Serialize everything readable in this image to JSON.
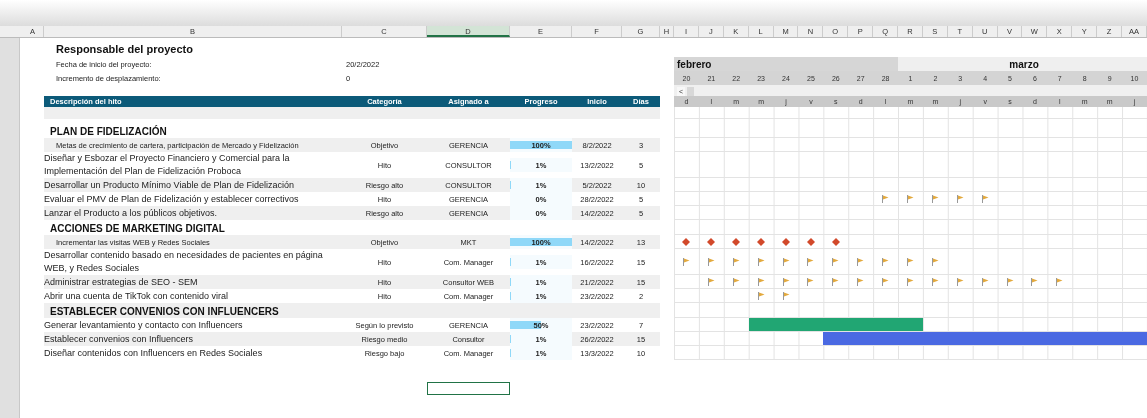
{
  "column_headers": [
    {
      "label": "A",
      "selected": false
    },
    {
      "label": "B",
      "selected": false
    },
    {
      "label": "C",
      "selected": false
    },
    {
      "label": "D",
      "selected": true
    },
    {
      "label": "E",
      "selected": false
    },
    {
      "label": "F",
      "selected": false
    },
    {
      "label": "G",
      "selected": false
    },
    {
      "label": "H",
      "selected": false
    },
    {
      "label": "I",
      "selected": false
    },
    {
      "label": "J",
      "selected": false
    },
    {
      "label": "K",
      "selected": false
    },
    {
      "label": "L",
      "selected": false
    },
    {
      "label": "M",
      "selected": false
    },
    {
      "label": "N",
      "selected": false
    },
    {
      "label": "O",
      "selected": false
    },
    {
      "label": "P",
      "selected": false
    },
    {
      "label": "Q",
      "selected": false
    },
    {
      "label": "R",
      "selected": false
    },
    {
      "label": "S",
      "selected": false
    },
    {
      "label": "T",
      "selected": false
    },
    {
      "label": "U",
      "selected": false
    },
    {
      "label": "V",
      "selected": false
    },
    {
      "label": "W",
      "selected": false
    },
    {
      "label": "X",
      "selected": false
    },
    {
      "label": "Y",
      "selected": false
    },
    {
      "label": "Z",
      "selected": false
    },
    {
      "label": "AA",
      "selected": false
    }
  ],
  "project": {
    "title": "Responsable del proyecto",
    "fields": [
      {
        "label": "Fecha de inicio del proyecto:",
        "value": "20/2/2022"
      },
      {
        "label": "Incremento de desplazamiento:",
        "value": "0"
      }
    ]
  },
  "timeline": {
    "scroll_button": "<",
    "months": [
      {
        "label": "febrero",
        "days": [
          {
            "day": "20",
            "weekday": "d"
          },
          {
            "day": "21",
            "weekday": "l"
          },
          {
            "day": "22",
            "weekday": "m"
          },
          {
            "day": "23",
            "weekday": "m"
          },
          {
            "day": "24",
            "weekday": "j"
          },
          {
            "day": "25",
            "weekday": "v"
          },
          {
            "day": "26",
            "weekday": "s"
          },
          {
            "day": "27",
            "weekday": "d"
          },
          {
            "day": "28",
            "weekday": "l"
          }
        ]
      },
      {
        "label": "marzo",
        "days": [
          {
            "day": "1",
            "weekday": "m"
          },
          {
            "day": "2",
            "weekday": "m"
          },
          {
            "day": "3",
            "weekday": "j"
          },
          {
            "day": "4",
            "weekday": "v"
          },
          {
            "day": "5",
            "weekday": "s"
          },
          {
            "day": "6",
            "weekday": "d"
          },
          {
            "day": "7",
            "weekday": "l"
          },
          {
            "day": "8",
            "weekday": "m"
          },
          {
            "day": "9",
            "weekday": "m"
          },
          {
            "day": "10",
            "weekday": "j"
          }
        ]
      }
    ]
  },
  "table": {
    "columns": [
      "Descripción del hito",
      "Categoría",
      "Asignado a",
      "Progreso",
      "Inicio",
      "Días"
    ],
    "rows": [
      {
        "kind": "section",
        "title": "PLAN DE FIDELIZACIÓN"
      },
      {
        "kind": "objective",
        "description": "Metas de crecimiento de cartera, participación de Mercado y Fidelización",
        "category": "Objetivo",
        "assigned": "GERENCIA",
        "progress": "100%",
        "level": 1,
        "start": "8/2/2022",
        "days": "3"
      },
      {
        "kind": "task",
        "description": "Diseñar y Esbozar el Proyecto Financiero y Comercial para la Implementación del Plan de Fidelización Proboca",
        "category": "Hito",
        "assigned": "CONSULTOR",
        "progress": "1%",
        "level": 0.01,
        "start": "13/2/2022",
        "days": "5"
      },
      {
        "kind": "task",
        "description": "Desarrollar un Producto Mínimo Viable de Plan de Fidelización",
        "category": "Riesgo alto",
        "assigned": "CONSULTOR",
        "progress": "1%",
        "level": 0.01,
        "start": "5/2/2022",
        "days": "10"
      },
      {
        "kind": "task",
        "description": "Evaluar el PMV de Plan de Fidelización y establecer correctivos",
        "category": "Hito",
        "assigned": "GERENCIA",
        "progress": "0%",
        "start": "28/2/2022",
        "days": "5",
        "gantt": [
          {
            "kind": "none"
          },
          {
            "kind": "none"
          },
          {
            "kind": "none"
          },
          {
            "kind": "none"
          },
          {
            "kind": "none"
          },
          {
            "kind": "none"
          },
          {
            "kind": "none"
          },
          {
            "kind": "none"
          },
          {
            "kind": "flag"
          },
          {
            "kind": "flag"
          },
          {
            "kind": "flag"
          },
          {
            "kind": "flag"
          },
          {
            "kind": "flag"
          }
        ]
      },
      {
        "kind": "task",
        "description": "Lanzar el Producto a los públicos objetivos.",
        "category": "Riesgo alto",
        "assigned": "GERENCIA",
        "progress": "0%",
        "start": "14/2/2022",
        "days": "5"
      },
      {
        "kind": "section",
        "title": "ACCIONES DE MARKETING DIGITAL"
      },
      {
        "kind": "objective",
        "description": "Incrementar las visitas WEB y Redes Sociales",
        "category": "Objetivo",
        "assigned": "MKT",
        "progress": "100%",
        "level": 1,
        "start": "14/2/2022",
        "days": "13",
        "gantt": [
          {
            "kind": "diamond"
          },
          {
            "kind": "diamond"
          },
          {
            "kind": "diamond"
          },
          {
            "kind": "diamond"
          },
          {
            "kind": "diamond"
          },
          {
            "kind": "diamond"
          },
          {
            "kind": "diamond"
          }
        ]
      },
      {
        "kind": "task",
        "description": "Desarrollar contenido basado en necesidades de pacientes en página WEB, y Redes Sociales",
        "category": "Hito",
        "assigned": "Com. Manager",
        "progress": "1%",
        "level": 0.01,
        "start": "16/2/2022",
        "days": "15",
        "gantt": [
          {
            "kind": "flag"
          },
          {
            "kind": "flag"
          },
          {
            "kind": "flag"
          },
          {
            "kind": "flag"
          },
          {
            "kind": "flag"
          },
          {
            "kind": "flag"
          },
          {
            "kind": "flag"
          },
          {
            "kind": "flag"
          },
          {
            "kind": "flag"
          },
          {
            "kind": "flag"
          },
          {
            "kind": "flag"
          }
        ]
      },
      {
        "kind": "task",
        "description": "Administrar estrategias de SEO - SEM",
        "category": "Hito",
        "assigned": "Consultor WEB",
        "progress": "1%",
        "level": 0.01,
        "start": "21/2/2022",
        "days": "15",
        "gantt": [
          {
            "kind": "none"
          },
          {
            "kind": "flag"
          },
          {
            "kind": "flag"
          },
          {
            "kind": "flag"
          },
          {
            "kind": "flag"
          },
          {
            "kind": "flag"
          },
          {
            "kind": "flag"
          },
          {
            "kind": "flag"
          },
          {
            "kind": "flag"
          },
          {
            "kind": "flag"
          },
          {
            "kind": "flag"
          },
          {
            "kind": "flag"
          },
          {
            "kind": "flag"
          },
          {
            "kind": "flag"
          },
          {
            "kind": "flag"
          },
          {
            "kind": "flag"
          }
        ]
      },
      {
        "kind": "task",
        "description": "Abrir una cuenta de TikTok con contenido viral",
        "category": "Hito",
        "assigned": "Com. Manager",
        "progress": "1%",
        "level": 0.01,
        "start": "23/2/2022",
        "days": "2",
        "gantt": [
          {
            "kind": "none"
          },
          {
            "kind": "none"
          },
          {
            "kind": "none"
          },
          {
            "kind": "flag"
          },
          {
            "kind": "flag"
          }
        ]
      },
      {
        "kind": "section",
        "title": "ESTABLECER CONVENIOS CON INFLUENCERS"
      },
      {
        "kind": "task",
        "description": "Generar levantamiento y contacto con Influencers",
        "category": "Según lo previsto",
        "assigned": "GERENCIA",
        "progress": "50%",
        "level": 0.5,
        "start": "23/2/2022",
        "days": "7",
        "color": "#21a673",
        "gantt": [
          {
            "kind": "none"
          },
          {
            "kind": "none"
          },
          {
            "kind": "none"
          },
          {
            "kind": "bar"
          },
          {
            "kind": "bar"
          },
          {
            "kind": "bar"
          },
          {
            "kind": "bar"
          },
          {
            "kind": "bar"
          },
          {
            "kind": "bar"
          },
          {
            "kind": "bar"
          }
        ]
      },
      {
        "kind": "task",
        "description": "Establecer convenios con Influencers",
        "category": "Riesgo medio",
        "assigned": "Consultor",
        "progress": "1%",
        "level": 0.01,
        "start": "26/2/2022",
        "days": "15",
        "color": "#4a69e2",
        "gantt": [
          {
            "kind": "none"
          },
          {
            "kind": "none"
          },
          {
            "kind": "none"
          },
          {
            "kind": "none"
          },
          {
            "kind": "none"
          },
          {
            "kind": "none"
          },
          {
            "kind": "bar"
          },
          {
            "kind": "bar"
          },
          {
            "kind": "bar"
          },
          {
            "kind": "bar"
          },
          {
            "kind": "bar"
          },
          {
            "kind": "bar"
          },
          {
            "kind": "bar"
          },
          {
            "kind": "bar"
          },
          {
            "kind": "bar"
          },
          {
            "kind": "bar"
          },
          {
            "kind": "bar"
          },
          {
            "kind": "bar"
          },
          {
            "kind": "bar"
          }
        ]
      },
      {
        "kind": "task",
        "description": "Diseñar contenidos con Influencers en Redes Sociales",
        "category": "Riesgo bajo",
        "assigned": "Com. Manager",
        "progress": "1%",
        "level": 0.01,
        "start": "13/3/2022",
        "days": "10"
      }
    ]
  }
}
